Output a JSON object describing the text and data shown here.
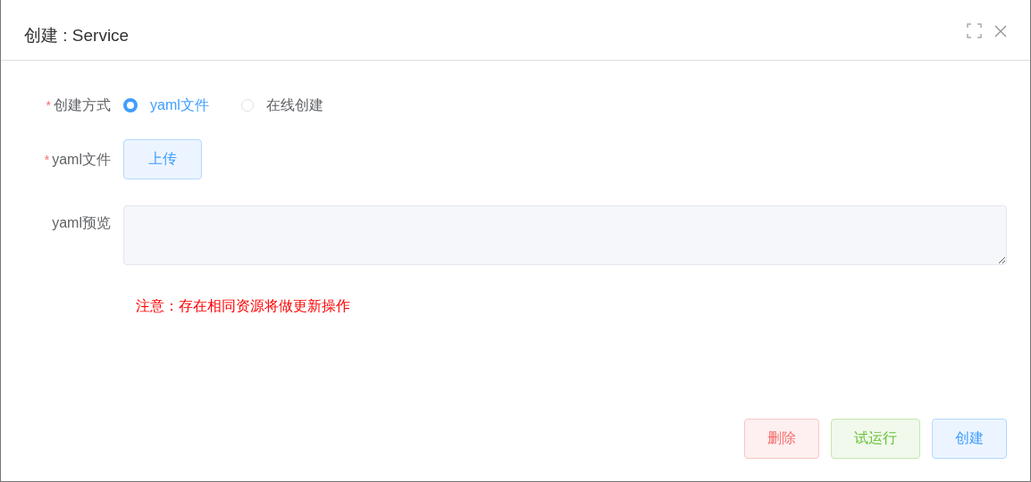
{
  "dialog": {
    "title": "创建 : Service"
  },
  "form": [
    {
      "kind": "radio",
      "label": "创建方式",
      "required_mark": "*",
      "options": [
        {
          "label": "yaml文件",
          "selected": true
        },
        {
          "label": "在线创建",
          "selected": false
        }
      ]
    },
    {
      "kind": "upload",
      "label": "yaml文件",
      "required_mark": "*",
      "button": "上传"
    },
    {
      "kind": "textarea",
      "label": "yaml预览"
    }
  ],
  "note": "注意：存在相同资源将做更新操作",
  "buttons": [
    {
      "label": "删除",
      "kind": "danger"
    },
    {
      "label": "试运行",
      "kind": "success"
    },
    {
      "label": "创建",
      "kind": "primary"
    }
  ]
}
